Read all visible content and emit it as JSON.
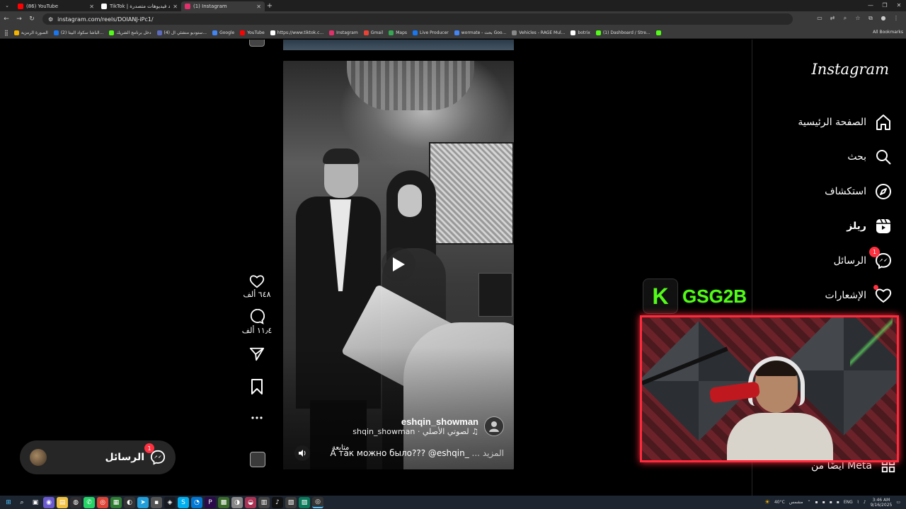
{
  "browser": {
    "tabs": [
      {
        "title": "(86) YouTube",
        "color": "#ff0000",
        "active": false
      },
      {
        "title": "TikTok | شاهد فيديوهات متصدرة",
        "color": "#ffffff",
        "active": false
      },
      {
        "title": "(1) Instagram",
        "color": "#e1306c",
        "active": true
      }
    ],
    "url": "instagram.com/reels/DOIANJ-iPc1/",
    "bookmarks": [
      {
        "label": "الصورة الرمزية",
        "color": "#f4b400"
      },
      {
        "label": "(2) الباشا سكواد البيتا...",
        "color": "#1877f2"
      },
      {
        "label": "دخل برنامج الشريك",
        "color": "#53fc18"
      },
      {
        "label": "(4) ستوديو منشئي ال...",
        "color": "#5c6bc0"
      },
      {
        "label": "Google",
        "color": "#4285f4"
      },
      {
        "label": "YouTube",
        "color": "#ff0000"
      },
      {
        "label": "https://www.tiktok.c...",
        "color": "#ffffff"
      },
      {
        "label": "Instagram",
        "color": "#e1306c"
      },
      {
        "label": "Gmail",
        "color": "#ea4335"
      },
      {
        "label": "Maps",
        "color": "#34a853"
      },
      {
        "label": "Live Producer",
        "color": "#1877f2"
      },
      {
        "label": "wormate - بحث Goo...",
        "color": "#4285f4"
      },
      {
        "label": "Vehicles - RAGE Mul...",
        "color": "#888888"
      },
      {
        "label": "botrix",
        "color": "#ffffff"
      },
      {
        "label": "(1) Dashboard / Stre...",
        "color": "#53fc18"
      }
    ],
    "all_bookmarks": "All Bookmarks"
  },
  "reel": {
    "author": "eshqin_showman",
    "audio": "shqin_showman · لصوتي الأصلي ♫",
    "follow": "متابعة",
    "caption": "A так можно было??? @eshqin_",
    "caption_more": "... المزيد",
    "actions": {
      "likes": "٦٤٨ ألف",
      "comments": "١١٫٤ ألف"
    }
  },
  "messages_pill": {
    "label": "الرسائل",
    "badge": "1"
  },
  "sidebar": {
    "logo": "Instagram",
    "items": [
      {
        "label": "الصفحة الرئيسية",
        "icon": "home-icon"
      },
      {
        "label": "بحث",
        "icon": "search-icon"
      },
      {
        "label": "استكشاف",
        "icon": "explore-icon"
      },
      {
        "label": "ريلز",
        "icon": "reels-icon"
      },
      {
        "label": "الرسائل",
        "icon": "messenger-icon",
        "badge": "1"
      },
      {
        "label": "الإشعارات",
        "icon": "heart-icon"
      }
    ],
    "also_meta": "أيضًا من Meta"
  },
  "stream_overlay": {
    "platform_glyph": "K",
    "channel": "GSG2B",
    "accent": "#53fc18",
    "frame_color": "#ff2a3b"
  },
  "taskbar": {
    "weather": "40°C",
    "weather_label": "مشمس",
    "lang": "ENG",
    "time": "3:46 AM",
    "date": "9/16/2025"
  }
}
